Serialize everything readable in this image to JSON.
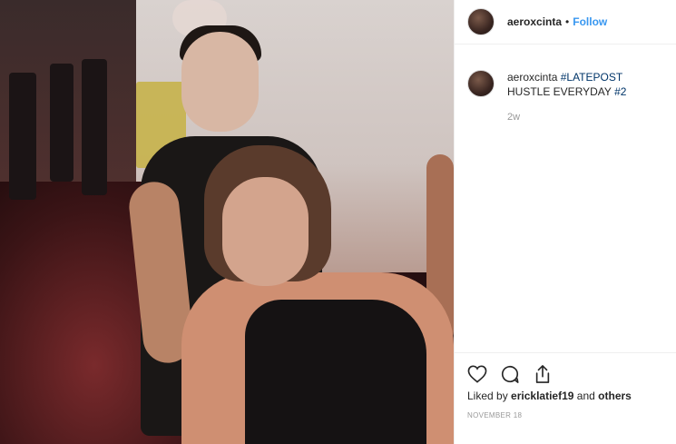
{
  "post": {
    "username": "aeroxcinta",
    "separator": "•",
    "follow_label": "Follow"
  },
  "caption": {
    "username": "aeroxcinta",
    "hashtag": "#LATEPOST",
    "text": "HUSTLE EVERYDAY",
    "hashtag2": "#2",
    "time_ago": "2w"
  },
  "footer": {
    "liked_by_prefix": "Liked by",
    "liked_by_user": "ericklatief19",
    "liked_by_and": "and",
    "liked_by_others": "others",
    "date": "NOVEMBER 18"
  },
  "icons": {
    "like": "heart-icon",
    "comment": "comment-icon",
    "share": "share-icon"
  },
  "colors": {
    "follow": "#3897f0",
    "hashtag": "#003569",
    "muted": "#999999"
  }
}
